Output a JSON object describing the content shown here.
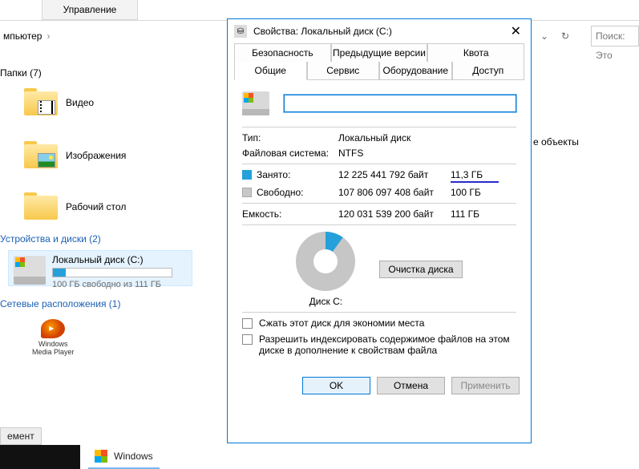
{
  "ribbon": {
    "manage": "Управление"
  },
  "breadcrumb": {
    "item": "мпьютер"
  },
  "search": {
    "placeholder": "Поиск: Это"
  },
  "sections": {
    "folders": "Папки (7)",
    "devices": "Устройства и диски (2)",
    "network": "Сетевые расположения (1)"
  },
  "folders": {
    "video": "Видео",
    "images": "Изображения",
    "desktop": "Рабочий стол"
  },
  "drive": {
    "name": "Локальный диск (C:)",
    "sub": "100 ГБ свободно из 111 ГБ"
  },
  "wmp": {
    "l1": "Windows",
    "l2": "Media Player"
  },
  "taskbar": {
    "tab": "емент",
    "window": "Windows"
  },
  "explorer_note": "е объекты",
  "dialog": {
    "title": "Свойства: Локальный диск (C:)",
    "tabs_row1": {
      "security": "Безопасность",
      "prev": "Предыдущие версии",
      "quota": "Квота"
    },
    "tabs_row2": {
      "general": "Общие",
      "service": "Сервис",
      "hardware": "Оборудование",
      "access": "Доступ"
    },
    "type_k": "Тип:",
    "type_v": "Локальный диск",
    "fs_k": "Файловая система:",
    "fs_v": "NTFS",
    "used_k": "Занято:",
    "used_bytes": "12 225 441 792 байт",
    "used_gb": "11,3 ГБ",
    "free_k": "Свободно:",
    "free_bytes": "107 806 097 408 байт",
    "free_gb": "100 ГБ",
    "cap_k": "Емкость:",
    "cap_bytes": "120 031 539 200 байт",
    "cap_gb": "111 ГБ",
    "pie_label": "Диск C:",
    "cleanup": "Очистка диска",
    "compress": "Сжать этот диск для экономии места",
    "index": "Разрешить индексировать содержимое файлов на этом диске в дополнение к свойствам файла",
    "ok": "OK",
    "cancel": "Отмена",
    "apply": "Применить"
  },
  "chart_data": {
    "type": "pie",
    "title": "Диск C:",
    "series": [
      {
        "name": "Занято",
        "value_bytes": 12225441792,
        "value_gb": 11.3
      },
      {
        "name": "Свободно",
        "value_bytes": 107806097408,
        "value_gb": 100
      }
    ],
    "total_bytes": 120031539200,
    "total_gb": 111
  }
}
